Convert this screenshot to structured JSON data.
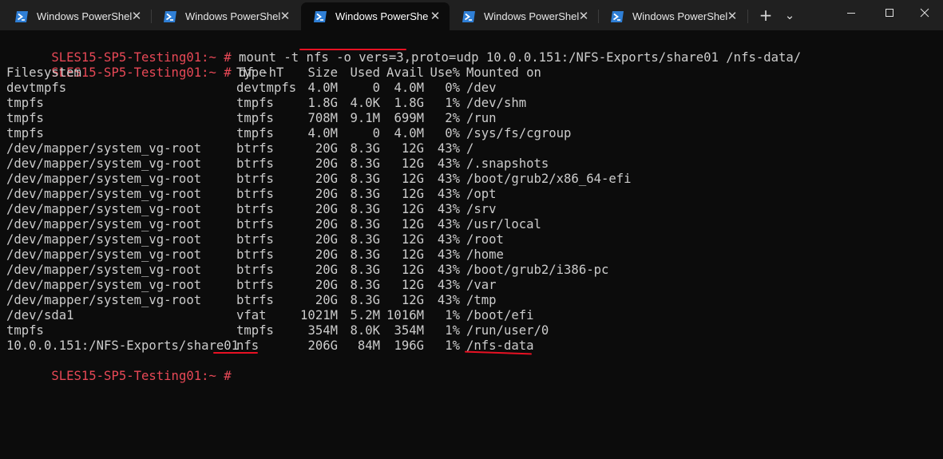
{
  "tabs": [
    {
      "title": "Windows PowerShel",
      "close": "✕"
    },
    {
      "title": "Windows PowerShel",
      "close": "✕"
    },
    {
      "title": "Windows PowerShe",
      "close": "✕"
    },
    {
      "title": "Windows PowerShel",
      "close": "✕"
    },
    {
      "title": "Windows PowerShel",
      "close": "✕"
    }
  ],
  "tab_actions": {
    "new_tab": "+",
    "dropdown": "⌄"
  },
  "colors": {
    "background": "#0c0c0c",
    "tabbar": "#202020",
    "prompt": "#e74856",
    "text": "#cccccc",
    "annotation": "#e81123",
    "powershell_icon": "#2f7fd6"
  },
  "terminal": {
    "command1": {
      "prompt": "SLES15-SP5-Testing01:~ #",
      "command": " mount -t nfs -o vers=3,proto=udp 10.0.0.151:/NFS-Exports/share01 /nfs-data/"
    },
    "command2": {
      "prompt": "SLES15-SP5-Testing01:~ #",
      "command": " df -hT"
    },
    "df_headers": [
      "Filesystem",
      "Type",
      "Size",
      "Used",
      "Avail",
      "Use%",
      "Mounted on"
    ],
    "df_rows": [
      [
        "devtmpfs",
        "devtmpfs",
        "4.0M",
        "0",
        "4.0M",
        "0%",
        "/dev"
      ],
      [
        "tmpfs",
        "tmpfs",
        "1.8G",
        "4.0K",
        "1.8G",
        "1%",
        "/dev/shm"
      ],
      [
        "tmpfs",
        "tmpfs",
        "708M",
        "9.1M",
        "699M",
        "2%",
        "/run"
      ],
      [
        "tmpfs",
        "tmpfs",
        "4.0M",
        "0",
        "4.0M",
        "0%",
        "/sys/fs/cgroup"
      ],
      [
        "/dev/mapper/system_vg-root",
        "btrfs",
        "20G",
        "8.3G",
        "12G",
        "43%",
        "/"
      ],
      [
        "/dev/mapper/system_vg-root",
        "btrfs",
        "20G",
        "8.3G",
        "12G",
        "43%",
        "/.snapshots"
      ],
      [
        "/dev/mapper/system_vg-root",
        "btrfs",
        "20G",
        "8.3G",
        "12G",
        "43%",
        "/boot/grub2/x86_64-efi"
      ],
      [
        "/dev/mapper/system_vg-root",
        "btrfs",
        "20G",
        "8.3G",
        "12G",
        "43%",
        "/opt"
      ],
      [
        "/dev/mapper/system_vg-root",
        "btrfs",
        "20G",
        "8.3G",
        "12G",
        "43%",
        "/srv"
      ],
      [
        "/dev/mapper/system_vg-root",
        "btrfs",
        "20G",
        "8.3G",
        "12G",
        "43%",
        "/usr/local"
      ],
      [
        "/dev/mapper/system_vg-root",
        "btrfs",
        "20G",
        "8.3G",
        "12G",
        "43%",
        "/root"
      ],
      [
        "/dev/mapper/system_vg-root",
        "btrfs",
        "20G",
        "8.3G",
        "12G",
        "43%",
        "/home"
      ],
      [
        "/dev/mapper/system_vg-root",
        "btrfs",
        "20G",
        "8.3G",
        "12G",
        "43%",
        "/boot/grub2/i386-pc"
      ],
      [
        "/dev/mapper/system_vg-root",
        "btrfs",
        "20G",
        "8.3G",
        "12G",
        "43%",
        "/var"
      ],
      [
        "/dev/mapper/system_vg-root",
        "btrfs",
        "20G",
        "8.3G",
        "12G",
        "43%",
        "/tmp"
      ],
      [
        "/dev/sda1",
        "vfat",
        "1021M",
        "5.2M",
        "1016M",
        "1%",
        "/boot/efi"
      ],
      [
        "tmpfs",
        "tmpfs",
        "354M",
        "8.0K",
        "354M",
        "1%",
        "/run/user/0"
      ],
      [
        "10.0.0.151:/NFS-Exports/share01",
        "nfs",
        "206G",
        "84M",
        "196G",
        "1%",
        "/nfs-data"
      ]
    ],
    "final_prompt": "SLES15-SP5-Testing01:~ #"
  }
}
